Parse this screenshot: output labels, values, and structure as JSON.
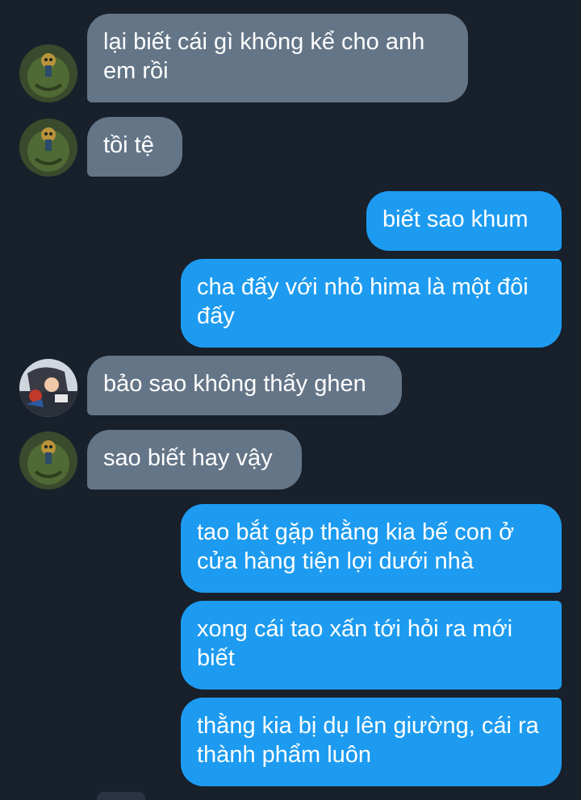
{
  "conversation": {
    "messages": [
      {
        "side": "incoming",
        "avatar": "frog-avatar",
        "text": "lại biết cái gì không kể cho anh em rồi"
      },
      {
        "side": "incoming",
        "avatar": "frog-avatar",
        "text": "tồi tệ"
      },
      {
        "side": "outgoing",
        "text": "biết sao khum"
      },
      {
        "side": "outgoing",
        "text": "cha đấy với nhỏ hima là một đôi đấy"
      },
      {
        "side": "incoming",
        "avatar": "anime-avatar",
        "text": "bảo sao không thấy ghen"
      },
      {
        "side": "incoming",
        "avatar": "frog-avatar",
        "text": "sao biết hay vậy"
      },
      {
        "side": "outgoing",
        "text": "tao bắt gặp thằng kia bế con ở cửa hàng tiện lợi dưới nhà"
      },
      {
        "side": "outgoing",
        "text": "xong cái tao xấn tới hỏi ra mới biết"
      },
      {
        "side": "outgoing",
        "text": "thằng kia bị dụ lên giường, cái ra thành phẩm luôn"
      }
    ]
  },
  "colors": {
    "background": "#18202b",
    "incoming_bubble": "#647587",
    "outgoing_bubble": "#1d9bf0",
    "text": "#ffffff"
  }
}
